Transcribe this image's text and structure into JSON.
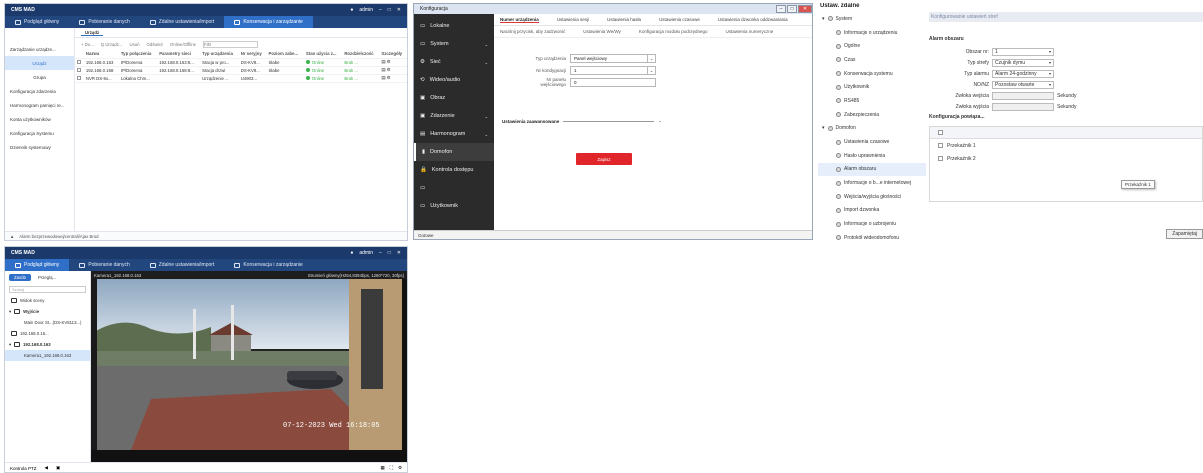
{
  "cms": {
    "app_title": "CMS MAD",
    "window_right": "admin",
    "tabs": [
      "Podgląd główny",
      "Pobieranie danych",
      "Zdalne ustawienia/import",
      "Konserwacja i zarządzanie"
    ]
  },
  "devices": {
    "sidebar": [
      "Zarządzanie urządze...",
      "Urządz",
      "Grupa",
      "Konfiguracja zdarzenia",
      "Harmonogram pamięci re...",
      "Konta użytkowników",
      "Konfiguracja Systemu",
      "Dziennik systemowy"
    ],
    "subtab": "Urządz",
    "toolbar": [
      "+ Do...",
      "Q Urządz...",
      "Usuń",
      "Odśwież",
      "Online/Offline"
    ],
    "search_placeholder": "Filtr",
    "columns": [
      "Nazwa",
      "Typ połączenia",
      "Parametry sieci",
      "Typ urządzenia",
      "Nr seryjny",
      "Poziom zabe...",
      "Stan użycia z...",
      "Rozdzielczość",
      "Szczegóły"
    ],
    "rows": [
      [
        "192.168.0.163",
        "IP/Domena",
        "192.168.0.163:8...",
        "Stacja w pro...",
        "DS-KV8...",
        "Słabe",
        "Online",
        "Brak ...",
        ""
      ],
      [
        "192.168.0.168",
        "IP/Domena",
        "192.168.0.168:8...",
        "Stacja drzwi",
        "DS-KV8...",
        "Słabe",
        "Online",
        "Brak ...",
        ""
      ],
      [
        "NVR DS-9x...",
        "Lokalna Chm...",
        "",
        "Urządzenie ...",
        "U4903...",
        "",
        "Online",
        "Brak ...",
        ""
      ]
    ],
    "status_text": "Alarm bezprzewodowej/centrali/Ajax Brud"
  },
  "config": {
    "window_title": "Konfiguracja",
    "menu": [
      "Lokalne",
      "System",
      "Sieć",
      "Wideo/audio",
      "Obraz",
      "Zdarzenie",
      "Harmonogram",
      "Domofon",
      "Kontrola dostępu",
      "",
      "Użytkownik"
    ],
    "tabs_row1": [
      "Numer urządzenia",
      "Ustawienia sesji",
      "Ustawienia hasła",
      "Ustawienia czasowe",
      "Ustawienia dzwonka oddzwaniania"
    ],
    "tabs_row2": [
      "Naciśnij przycisk, aby zadzwonić",
      "Ustawienia We/Wy",
      "Konfiguracja modułu podrzędnego",
      "Ustawienia numeryczne"
    ],
    "fields": [
      {
        "label": "Typ urządzenia",
        "value": "Panel wejściowy"
      },
      {
        "label": "Nr kondygnacji",
        "value": "1"
      },
      {
        "label": "Nr panelu wejściowego",
        "value": "0"
      }
    ],
    "advanced_label": "Ustawienia zaawansowane",
    "save_label": "Zapisz",
    "footer": "Gotowe"
  },
  "remote": {
    "title": "Ustaw. zdalne",
    "tree": [
      {
        "label": "System",
        "level": 0
      },
      {
        "label": "Informacje o urządzeniu",
        "level": 1
      },
      {
        "label": "Ogólne",
        "level": 1
      },
      {
        "label": "Czas",
        "level": 1
      },
      {
        "label": "Konserwacja systemu",
        "level": 1
      },
      {
        "label": "Użytkownik",
        "level": 1
      },
      {
        "label": "RS485",
        "level": 1
      },
      {
        "label": "Zabezpieczenia",
        "level": 1
      },
      {
        "label": "Domofon",
        "level": 0
      },
      {
        "label": "Ustawienia czasowe",
        "level": 1
      },
      {
        "label": "Hasło uprawnienia",
        "level": 1
      },
      {
        "label": "Alarm obszaru",
        "level": 1,
        "active": true
      },
      {
        "label": "Informacje o b...e internetowej",
        "level": 1
      },
      {
        "label": "Wejścia/wyjścia głośności",
        "level": 1
      },
      {
        "label": "Import dzwonka",
        "level": 1
      },
      {
        "label": "Informacje o uzbrojeniu",
        "level": 1
      },
      {
        "label": "Protokół wideodomofonu",
        "level": 1
      }
    ],
    "header_bar": "Konfigurowanie ustawień stref",
    "section": "Alarm obszaru",
    "fields": [
      {
        "label": "Obszar nr:",
        "value": "1",
        "unit": "",
        "disabled": false
      },
      {
        "label": "Typ strefy",
        "value": "Czujnik dymu",
        "unit": "",
        "disabled": false
      },
      {
        "label": "Typ alarmu",
        "value": "Alarm 24-godzinny",
        "unit": "",
        "disabled": false
      },
      {
        "label": "NO/NZ",
        "value": "Pozostaw otwarte",
        "unit": "",
        "disabled": false
      },
      {
        "label": "Zwłoka wejścia",
        "value": "",
        "unit": "Sekundy",
        "disabled": true
      },
      {
        "label": "Zwłoka wyjścia",
        "value": "",
        "unit": "Sekundy",
        "disabled": true
      }
    ],
    "link_section": "Konfiguracja powiąza...",
    "relays": [
      "Przekaźnik 1",
      "Przekaźnik 2"
    ],
    "tooltip": "Przekaźnik 1",
    "save_label": "Zapamiętaj"
  },
  "live": {
    "segments": [
      "Zasób",
      "Przeglą..."
    ],
    "search_placeholder": "Szukaj",
    "tree": [
      "Widok sceny",
      "Wyjście",
      "Main Door St...(DS-KV8113...)",
      "192.168.0.16...",
      "192.168.0.163",
      "Kamera1_192.168.0.163"
    ],
    "video_title": "Kamera1_192.168.0.163",
    "video_info": "Strumień główny(H264,8394bps, 1280*720, 30fps)",
    "osd_time": "07-12-2023 Wed 16:18:05",
    "bottom_label": "Kontrola PTZ"
  }
}
